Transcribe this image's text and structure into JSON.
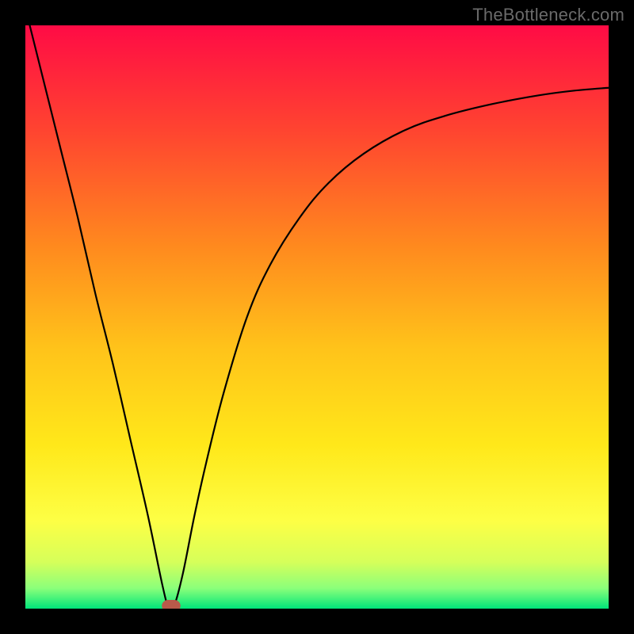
{
  "watermark": {
    "text": "TheBottleneck.com"
  },
  "chart_data": {
    "type": "line",
    "title": "",
    "xlabel": "",
    "ylabel": "",
    "xlim": [
      0,
      100
    ],
    "ylim": [
      0,
      100
    ],
    "grid": false,
    "legend": false,
    "background_gradient": {
      "orientation": "vertical",
      "stops": [
        {
          "pos": 0.0,
          "color": "#ff0b45"
        },
        {
          "pos": 0.18,
          "color": "#ff4430"
        },
        {
          "pos": 0.38,
          "color": "#ff8a1e"
        },
        {
          "pos": 0.55,
          "color": "#ffc21a"
        },
        {
          "pos": 0.72,
          "color": "#ffe81a"
        },
        {
          "pos": 0.85,
          "color": "#fdff45"
        },
        {
          "pos": 0.92,
          "color": "#d6ff5a"
        },
        {
          "pos": 0.965,
          "color": "#8bff7a"
        },
        {
          "pos": 1.0,
          "color": "#00e67a"
        }
      ]
    },
    "series": [
      {
        "name": "curve",
        "stroke": "#000000",
        "stroke_width": 2.2,
        "x": [
          0,
          3,
          6,
          9,
          12,
          15,
          18,
          21,
          23.5,
          24.5,
          25.5,
          27,
          29,
          31,
          34,
          38,
          42,
          47,
          52,
          58,
          65,
          72,
          80,
          88,
          94,
          100
        ],
        "values": [
          103,
          91,
          79,
          67,
          54,
          42,
          29,
          16,
          4,
          0.5,
          0.5,
          6,
          16,
          25,
          37,
          50,
          59,
          67,
          73,
          78,
          82,
          84.5,
          86.5,
          88,
          88.8,
          89.3
        ]
      }
    ],
    "annotations": [
      {
        "name": "minimum-marker",
        "shape": "rounded-rect",
        "x": 25.0,
        "y": 0.5,
        "w": 3.2,
        "h": 2.0,
        "rx": 1.1,
        "fill": "#b85a4a"
      }
    ]
  }
}
